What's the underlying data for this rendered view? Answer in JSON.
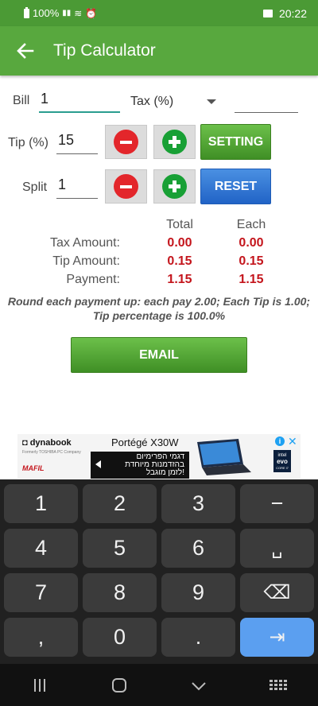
{
  "status_bar": {
    "battery": "100%",
    "time": "20:22"
  },
  "app_bar": {
    "title": "Tip Calculator"
  },
  "bill": {
    "label": "Bill",
    "value": "1"
  },
  "tax": {
    "select_label": "Tax (%)",
    "value": ""
  },
  "tip": {
    "label": "Tip (%)",
    "value": "15",
    "setting_label": "SETTING"
  },
  "split": {
    "label": "Split",
    "value": "1",
    "reset_label": "RESET"
  },
  "summary": {
    "col_total": "Total",
    "col_each": "Each",
    "rows": [
      {
        "label": "Tax Amount:",
        "total": "0.00",
        "each": "0.00"
      },
      {
        "label": "Tip Amount:",
        "total": "0.15",
        "each": "0.15"
      },
      {
        "label": "Payment:",
        "total": "1.15",
        "each": "1.15"
      }
    ]
  },
  "note": {
    "line1": "Round each payment up: each pay 2.00; Each Tip is 1.00;",
    "line2": "Tip percentage is 100.0%"
  },
  "email_label": "EMAIL",
  "ad": {
    "brand": "dynabook",
    "brand_sub": "Formerly TOSHIBA PC Company",
    "reseller": "MAFIL",
    "title": "Portégé X30W",
    "hebrew_line1": "דגמי הפרימיום",
    "hebrew_line2": "בהזדמנות מיוחדת",
    "hebrew_line3": "לזמן מוגבל!",
    "badge_line1": "intel",
    "badge_line2": "evo",
    "badge_line3": "CORE i7",
    "info_glyph": "i",
    "close_glyph": "✕"
  },
  "keyboard": {
    "keys": [
      "1",
      "2",
      "3",
      "−",
      "4",
      "5",
      "6",
      "␣",
      "7",
      "8",
      "9",
      "⌫",
      ",",
      "0",
      ".",
      "⇥"
    ]
  },
  "colors": {
    "status_bar": "#4b9a35",
    "app_bar": "#58a83e",
    "value_red": "#c4151c",
    "reset_blue": "#2163c6",
    "enter_key": "#5b9ff0"
  }
}
